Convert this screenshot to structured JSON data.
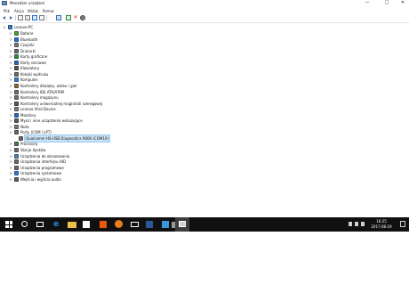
{
  "window": {
    "title": "Menedżer urządzeń",
    "controls": {
      "minimize": "—",
      "maximize": "□",
      "close": "✕"
    }
  },
  "menu": {
    "items": [
      "Plik",
      "Akcja",
      "Widok",
      "Pomoc"
    ]
  },
  "toolbar": {
    "icons": [
      "back-icon",
      "forward-icon",
      "properties-icon",
      "properties-icon-2",
      "help-icon",
      "view-icon",
      "monitor-icon",
      "update-driver-icon",
      "disable-icon",
      "uninstall-icon",
      "scan-icon"
    ]
  },
  "tree": {
    "root": "Lenovo-PC",
    "items": [
      {
        "label": "Baterie",
        "expander": ">",
        "icon_color": "#5a9a4a"
      },
      {
        "label": "Bluetooth",
        "expander": ">",
        "icon_color": "#2c6fd1"
      },
      {
        "label": "Czujniki",
        "expander": ">",
        "icon_color": "#7a7a7a"
      },
      {
        "label": "Drukarki",
        "expander": ">",
        "icon_color": "#6a6a6a"
      },
      {
        "label": "Karty graficzne",
        "expander": ">",
        "icon_color": "#3b8a3b"
      },
      {
        "label": "Karty sieciowe",
        "expander": ">",
        "icon_color": "#2f6db5"
      },
      {
        "label": "Klawiatury",
        "expander": ">",
        "icon_color": "#555555"
      },
      {
        "label": "Kolejki wydruku",
        "expander": ">",
        "icon_color": "#6d6d6d"
      },
      {
        "label": "Komputer",
        "expander": ">",
        "icon_color": "#3a7bc8"
      },
      {
        "label": "Kontrolery dźwięku, wideo i gier",
        "expander": ">",
        "icon_color": "#8a6d3b"
      },
      {
        "label": "Kontrolery IDE ATA/ATAPI",
        "expander": ">",
        "icon_color": "#6f6f6f"
      },
      {
        "label": "Kontrolery magazynu",
        "expander": ">",
        "icon_color": "#6f6f6f"
      },
      {
        "label": "Kontrolery uniwersalnej magistrali szeregowej",
        "expander": ">",
        "icon_color": "#5a5a5a"
      },
      {
        "label": "Lenovo Vhid Device",
        "expander": ">",
        "icon_color": "#7d7d7d"
      },
      {
        "label": "Monitory",
        "expander": ">",
        "icon_color": "#2f6db5"
      },
      {
        "label": "Mysz i inne urządzenia wskazujące",
        "expander": ">",
        "icon_color": "#5d5d5d"
      },
      {
        "label": "Nuta",
        "expander": ">",
        "icon_color": "#7a7a7a"
      },
      {
        "label": "Porty (COM i LPT)",
        "expander": "v",
        "icon_color": "#6b6b6b"
      },
      {
        "label": "Qualcomm HS-USB Diagnostics 9006 (COM10)",
        "expander": "",
        "icon_color": "#6b6b6b",
        "child": true,
        "selected": true
      },
      {
        "label": "Procesory",
        "expander": ">",
        "icon_color": "#4a7a4a"
      },
      {
        "label": "Stacje dysków",
        "expander": ">",
        "icon_color": "#6d6d6d"
      },
      {
        "label": "Urządzenia do obrazowania",
        "expander": ">",
        "icon_color": "#5b7fa8"
      },
      {
        "label": "Urządzenia interfejsu HID",
        "expander": ">",
        "icon_color": "#6a6a6a"
      },
      {
        "label": "Urządzenia programowe",
        "expander": ">",
        "icon_color": "#6a6a6a"
      },
      {
        "label": "Urządzenia systemowe",
        "expander": ">",
        "icon_color": "#3a7bc8"
      },
      {
        "label": "Wejścia i wyjścia audio",
        "expander": ">",
        "icon_color": "#5e5e5e"
      }
    ]
  },
  "taskbar": {
    "icons": [
      "start-icon",
      "search-icon",
      "task-view-icon",
      "edge-icon",
      "file-explorer-icon",
      "store-icon",
      "office-icon",
      "firefox-icon",
      "mail-icon",
      "word-icon",
      "photos-icon",
      "app-icon",
      "device-manager-icon"
    ],
    "time": "16:25",
    "date": "2017-08-29"
  }
}
